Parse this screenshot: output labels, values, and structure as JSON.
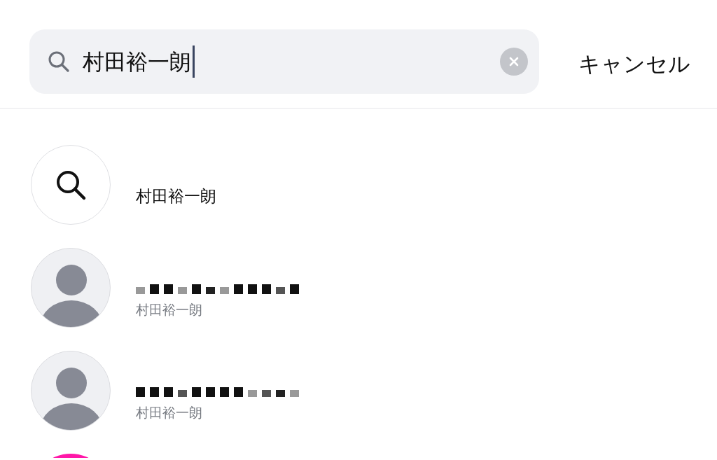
{
  "search": {
    "value": "村田裕一朗",
    "focused": true
  },
  "cancel_label": "キャンセル",
  "results": [
    {
      "kind": "query",
      "title": "村田裕一朗"
    },
    {
      "kind": "user",
      "subtitle": "村田裕一朗"
    },
    {
      "kind": "user",
      "subtitle": "村田裕一朗"
    },
    {
      "kind": "partial",
      "color": "#ff17a8"
    }
  ]
}
